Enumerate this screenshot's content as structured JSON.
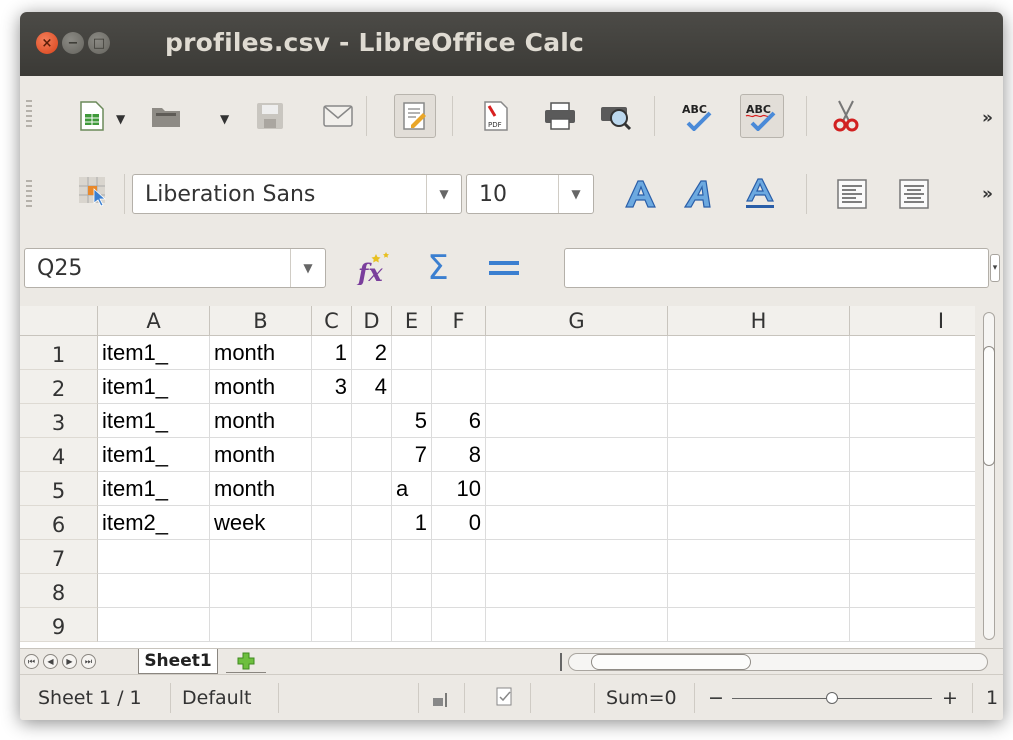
{
  "window": {
    "title": "profiles.csv - LibreOffice Calc"
  },
  "toolbar_std": {
    "icons": [
      "new-spreadsheet-icon",
      "open-folder-icon",
      "save-icon",
      "email-icon",
      "edit-mode-icon",
      "export-pdf-icon",
      "print-icon",
      "print-preview-icon",
      "spellcheck-icon",
      "autospellcheck-icon",
      "cut-icon"
    ],
    "more": "»"
  },
  "toolbar_fmt": {
    "font_name": "Liberation Sans",
    "font_size": "10",
    "more": "»"
  },
  "formula_bar": {
    "name_box": "Q25",
    "formula": ""
  },
  "columns": [
    "A",
    "B",
    "C",
    "D",
    "E",
    "F",
    "G",
    "H",
    "I"
  ],
  "rows": [
    {
      "num": "1",
      "cells": {
        "A": "item1_",
        "B": "month",
        "C": "1",
        "D": "2",
        "E": "",
        "F": ""
      }
    },
    {
      "num": "2",
      "cells": {
        "A": "item1_",
        "B": "month",
        "C": "3",
        "D": "4",
        "E": "",
        "F": ""
      }
    },
    {
      "num": "3",
      "cells": {
        "A": "item1_",
        "B": "month",
        "C": "",
        "D": "",
        "E": "5",
        "F": "6"
      }
    },
    {
      "num": "4",
      "cells": {
        "A": "item1_",
        "B": "month",
        "C": "",
        "D": "",
        "E": "7",
        "F": "8"
      }
    },
    {
      "num": "5",
      "cells": {
        "A": "item1_",
        "B": "month",
        "C": "",
        "D": "",
        "E": "a",
        "F": "10"
      }
    },
    {
      "num": "6",
      "cells": {
        "A": "item2_",
        "B": "week",
        "C": "",
        "D": "",
        "E": "1",
        "F": "0"
      }
    },
    {
      "num": "7",
      "cells": {}
    },
    {
      "num": "8",
      "cells": {}
    },
    {
      "num": "9",
      "cells": {}
    }
  ],
  "sheet_tab": {
    "name": "Sheet1"
  },
  "status": {
    "sheet": "Sheet 1 / 1",
    "style": "Default",
    "sum": "Sum=0",
    "zoom_minus": "−",
    "zoom_plus": "+",
    "zoom_value": "1"
  }
}
